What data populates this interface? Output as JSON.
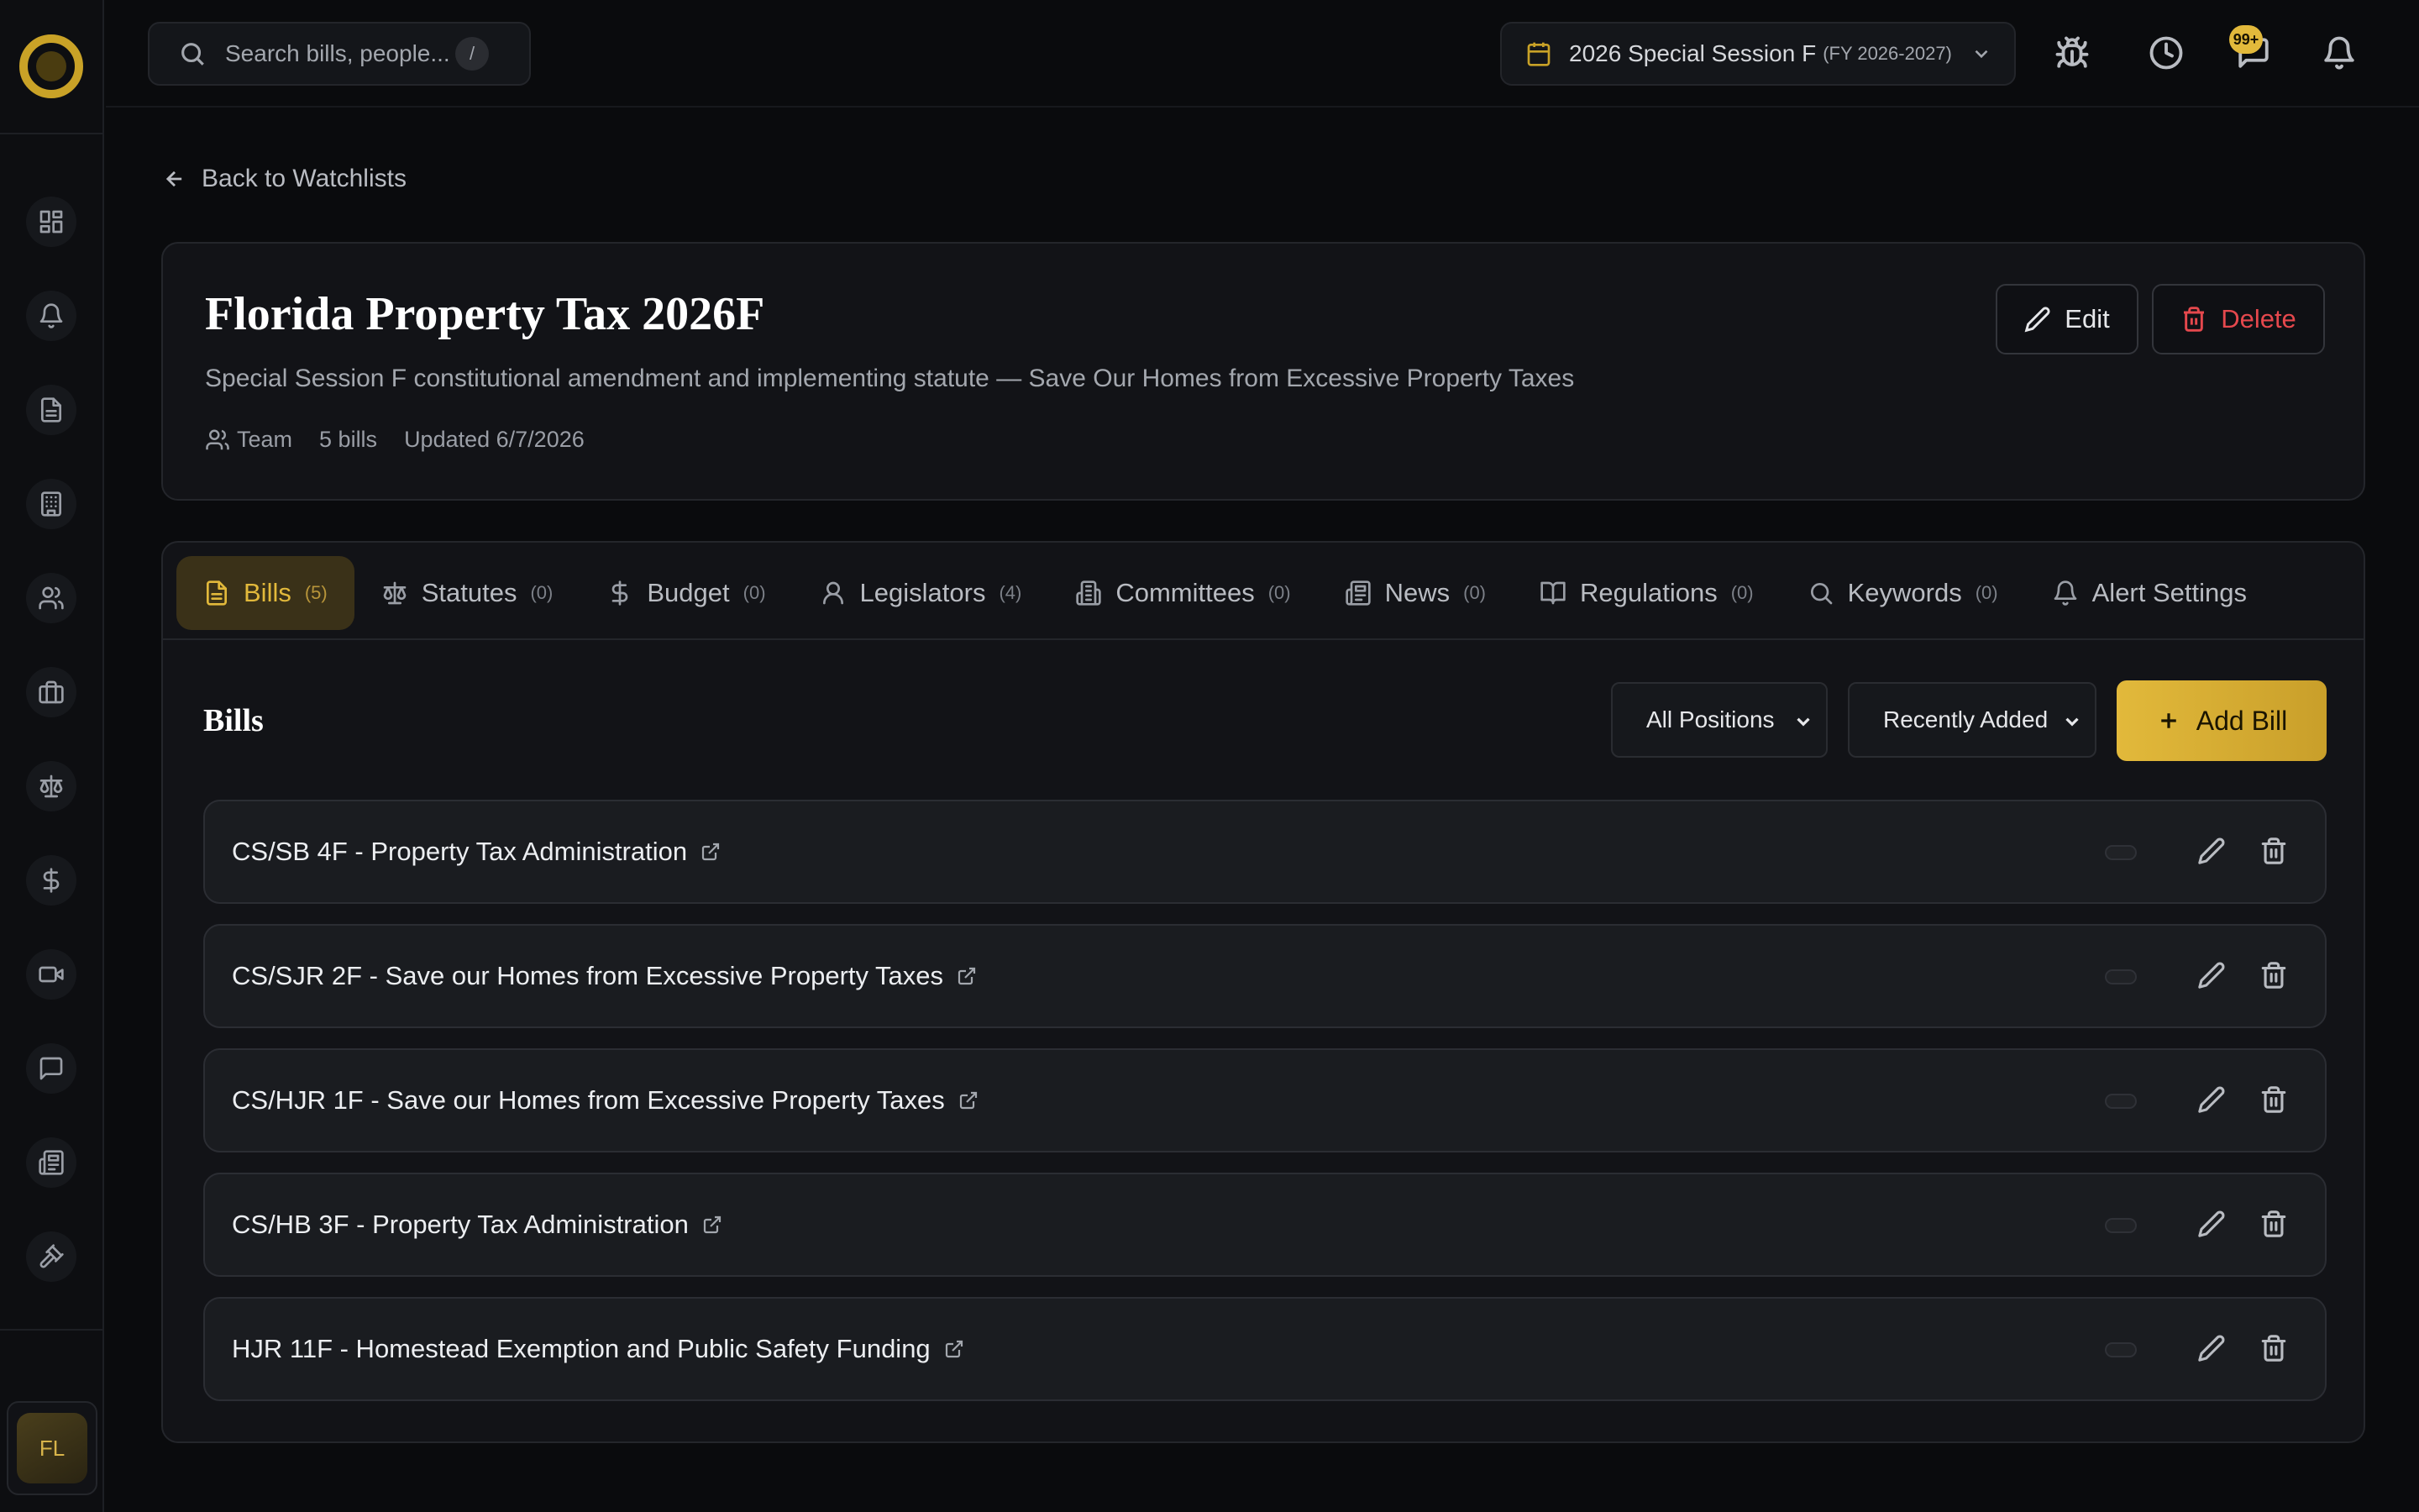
{
  "colors": {
    "accent": "#e2b93b",
    "danger": "#e5484d",
    "background": "#0a0b0d",
    "card": "#121317"
  },
  "sidebar": {
    "logo_icon": "app-logo",
    "items": [
      {
        "icon": "dashboard-icon"
      },
      {
        "icon": "bell-icon"
      },
      {
        "icon": "document-icon"
      },
      {
        "icon": "building-icon"
      },
      {
        "icon": "users-icon"
      },
      {
        "icon": "briefcase-icon"
      },
      {
        "icon": "scale-icon"
      },
      {
        "icon": "dollar-icon"
      },
      {
        "icon": "video-icon"
      },
      {
        "icon": "chat-icon"
      },
      {
        "icon": "newspaper-icon"
      },
      {
        "icon": "gavel-icon"
      }
    ],
    "user_initials": "FL"
  },
  "topbar": {
    "search_placeholder": "Search bills, people...",
    "search_shortcut": "/",
    "session_name": "2026 Special Session F",
    "session_fy": "(FY 2026-2027)",
    "notification_badge": "99+"
  },
  "back_link": "Back to Watchlists",
  "watchlist": {
    "title": "Florida Property Tax 2026F",
    "description": "Special Session F constitutional amendment and implementing statute — Save Our Homes from Excessive Property Taxes",
    "owner": "Team",
    "bill_count": "5 bills",
    "updated": "Updated 6/7/2026",
    "edit_label": "Edit",
    "delete_label": "Delete"
  },
  "tabs": [
    {
      "label": "Bills",
      "count": "(5)",
      "icon": "document-icon",
      "active": true
    },
    {
      "label": "Statutes",
      "count": "(0)",
      "icon": "scale-icon"
    },
    {
      "label": "Budget",
      "count": "(0)",
      "icon": "dollar-icon"
    },
    {
      "label": "Legislators",
      "count": "(4)",
      "icon": "user-icon"
    },
    {
      "label": "Committees",
      "count": "(0)",
      "icon": "building-icon"
    },
    {
      "label": "News",
      "count": "(0)",
      "icon": "newspaper-icon"
    },
    {
      "label": "Regulations",
      "count": "(0)",
      "icon": "book-icon"
    },
    {
      "label": "Keywords",
      "count": "(0)",
      "icon": "search-icon"
    },
    {
      "label": "Alert Settings",
      "count": "",
      "icon": "bell-icon"
    }
  ],
  "bills_section": {
    "title": "Bills",
    "position_filter": "All Positions",
    "sort": "Recently Added",
    "add_label": "Add Bill",
    "bills": [
      {
        "title": "CS/SB 4F - Property Tax Administration"
      },
      {
        "title": "CS/SJR 2F - Save our Homes from Excessive Property Taxes"
      },
      {
        "title": "CS/HJR 1F - Save our Homes from Excessive Property Taxes"
      },
      {
        "title": "CS/HB 3F - Property Tax Administration"
      },
      {
        "title": "HJR 11F - Homestead Exemption and Public Safety Funding"
      }
    ]
  }
}
